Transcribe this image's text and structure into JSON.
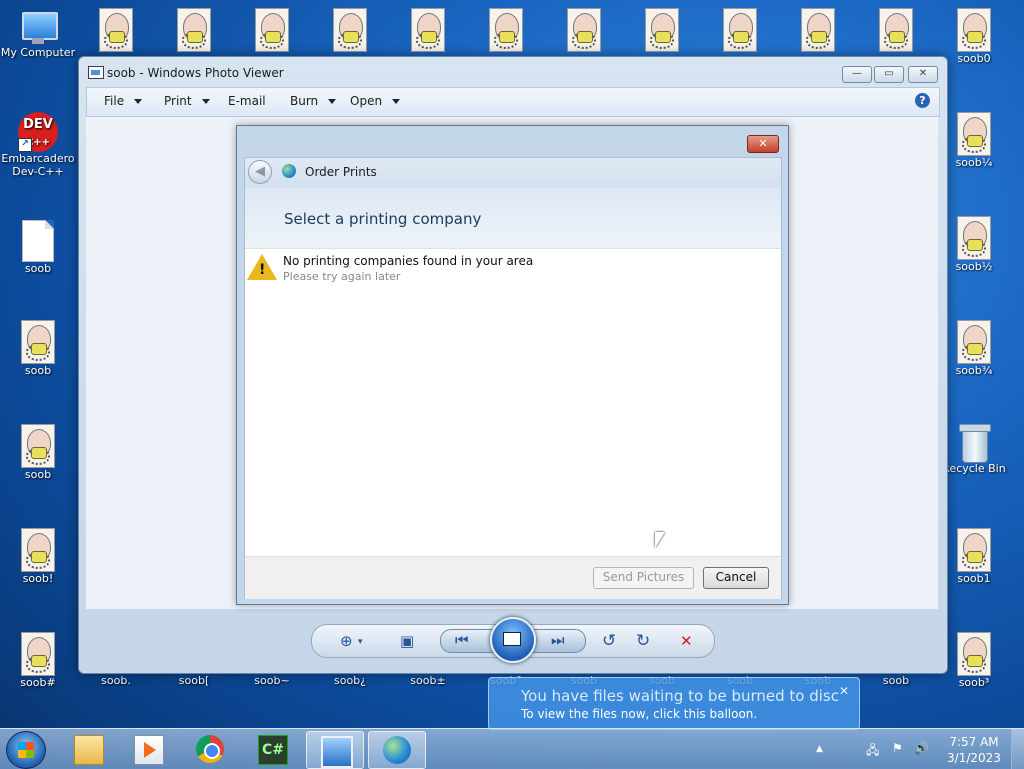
{
  "desktop": {
    "left_icons": [
      {
        "label": "My Computer",
        "type": "computer"
      },
      {
        "label": "Embarcadero Dev-C++",
        "type": "devcpp",
        "logo_text": "DEV",
        "logo_sub": "C++"
      },
      {
        "label": "soob",
        "type": "document"
      },
      {
        "label": "soob",
        "type": "face"
      },
      {
        "label": "soob",
        "type": "face"
      },
      {
        "label": "soob!",
        "type": "face"
      },
      {
        "label": "soob#",
        "type": "face"
      }
    ],
    "top_row_icons": [
      "",
      "",
      "",
      "",
      "",
      "",
      "",
      "",
      "",
      "",
      "",
      ""
    ],
    "right_icons": [
      {
        "label": "soob0",
        "type": "face"
      },
      {
        "label": "soob¼",
        "type": "face"
      },
      {
        "label": "soob½",
        "type": "face"
      },
      {
        "label": "soob¾",
        "type": "face"
      },
      {
        "label": "Recycle Bin",
        "type": "recycle-bin"
      },
      {
        "label": "soob1",
        "type": "face"
      },
      {
        "label": "soob³",
        "type": "face"
      }
    ],
    "bottom_row_labels": [
      "soob.",
      "soob[",
      "soob~",
      "soob¿",
      "soob±",
      "soob°",
      "soob",
      "soob",
      "soob",
      "soob",
      "soob"
    ]
  },
  "photo_viewer": {
    "title": "soob - Windows Photo Viewer",
    "caption_buttons": {
      "minimize": "—",
      "maximize": "▭",
      "close": "✕"
    },
    "menu": [
      {
        "label": "File",
        "has_dropdown": true
      },
      {
        "label": "Print",
        "has_dropdown": true
      },
      {
        "label": "E-mail",
        "has_dropdown": false
      },
      {
        "label": "Burn",
        "has_dropdown": true
      },
      {
        "label": "Open",
        "has_dropdown": true
      }
    ],
    "help_glyph": "?",
    "toolbar": {
      "zoom_glyph": "⊕",
      "actual_size_glyph": "▣",
      "previous_glyph": "⏮",
      "next_glyph": "⏭",
      "rotate_ccw_glyph": "↺",
      "rotate_cw_glyph": "↻",
      "delete_glyph": "✕"
    }
  },
  "order_prints_dialog": {
    "close_glyph": "✕",
    "back_glyph": "◀",
    "nav_title": "Order Prints",
    "heading": "Select a printing company",
    "message_title": "No printing companies found in your area",
    "message_detail": "Please try again later",
    "warning_glyph": "!",
    "send_button": "Send Pictures",
    "cancel_button": "Cancel"
  },
  "balloon": {
    "title": "You have files waiting to be burned to disc",
    "detail": "To view the files now, click this balloon.",
    "close_glyph": "✕"
  },
  "taskbar": {
    "apps": [
      {
        "name": "windows-explorer",
        "active": false
      },
      {
        "name": "windows-media-player",
        "active": false
      },
      {
        "name": "google-chrome",
        "active": false
      },
      {
        "name": "csharp-editor",
        "active": false,
        "glyph": "C#"
      },
      {
        "name": "windows-photo-viewer",
        "active": true
      },
      {
        "name": "order-prints",
        "active": true
      }
    ],
    "tray": {
      "show_hidden": "▲",
      "network": "🖧",
      "flag": "⚑",
      "volume": "🔊"
    },
    "time": "7:57 AM",
    "date": "3/1/2023"
  },
  "colors": {
    "desktop_blue": "#1a66c2",
    "dialog_frame": "#c4d6ea",
    "close_red": "#c4402a",
    "warning_yellow": "#e8b81c",
    "delete_red": "#d02020"
  }
}
